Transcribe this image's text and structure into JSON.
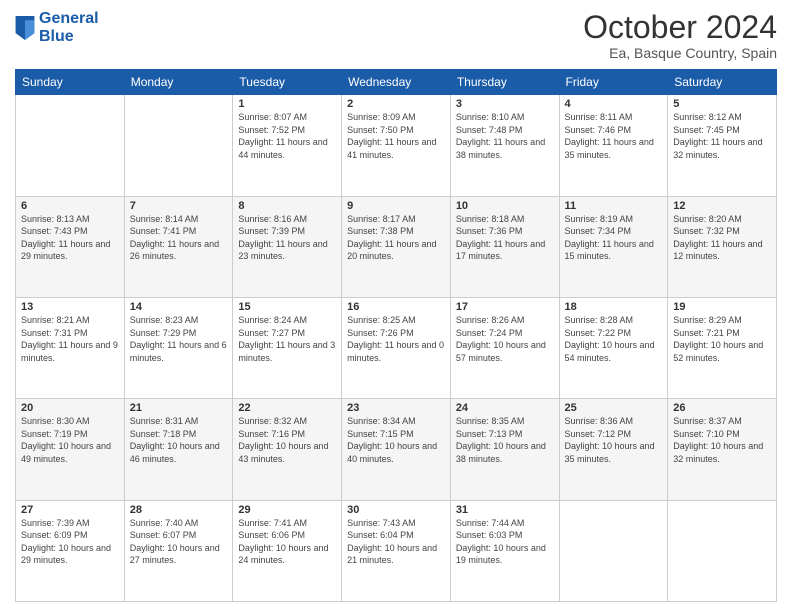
{
  "header": {
    "logo_line1": "General",
    "logo_line2": "Blue",
    "title": "October 2024",
    "subtitle": "Ea, Basque Country, Spain"
  },
  "days_of_week": [
    "Sunday",
    "Monday",
    "Tuesday",
    "Wednesday",
    "Thursday",
    "Friday",
    "Saturday"
  ],
  "weeks": [
    [
      {
        "num": "",
        "info": ""
      },
      {
        "num": "",
        "info": ""
      },
      {
        "num": "1",
        "info": "Sunrise: 8:07 AM\nSunset: 7:52 PM\nDaylight: 11 hours and 44 minutes."
      },
      {
        "num": "2",
        "info": "Sunrise: 8:09 AM\nSunset: 7:50 PM\nDaylight: 11 hours and 41 minutes."
      },
      {
        "num": "3",
        "info": "Sunrise: 8:10 AM\nSunset: 7:48 PM\nDaylight: 11 hours and 38 minutes."
      },
      {
        "num": "4",
        "info": "Sunrise: 8:11 AM\nSunset: 7:46 PM\nDaylight: 11 hours and 35 minutes."
      },
      {
        "num": "5",
        "info": "Sunrise: 8:12 AM\nSunset: 7:45 PM\nDaylight: 11 hours and 32 minutes."
      }
    ],
    [
      {
        "num": "6",
        "info": "Sunrise: 8:13 AM\nSunset: 7:43 PM\nDaylight: 11 hours and 29 minutes."
      },
      {
        "num": "7",
        "info": "Sunrise: 8:14 AM\nSunset: 7:41 PM\nDaylight: 11 hours and 26 minutes."
      },
      {
        "num": "8",
        "info": "Sunrise: 8:16 AM\nSunset: 7:39 PM\nDaylight: 11 hours and 23 minutes."
      },
      {
        "num": "9",
        "info": "Sunrise: 8:17 AM\nSunset: 7:38 PM\nDaylight: 11 hours and 20 minutes."
      },
      {
        "num": "10",
        "info": "Sunrise: 8:18 AM\nSunset: 7:36 PM\nDaylight: 11 hours and 17 minutes."
      },
      {
        "num": "11",
        "info": "Sunrise: 8:19 AM\nSunset: 7:34 PM\nDaylight: 11 hours and 15 minutes."
      },
      {
        "num": "12",
        "info": "Sunrise: 8:20 AM\nSunset: 7:32 PM\nDaylight: 11 hours and 12 minutes."
      }
    ],
    [
      {
        "num": "13",
        "info": "Sunrise: 8:21 AM\nSunset: 7:31 PM\nDaylight: 11 hours and 9 minutes."
      },
      {
        "num": "14",
        "info": "Sunrise: 8:23 AM\nSunset: 7:29 PM\nDaylight: 11 hours and 6 minutes."
      },
      {
        "num": "15",
        "info": "Sunrise: 8:24 AM\nSunset: 7:27 PM\nDaylight: 11 hours and 3 minutes."
      },
      {
        "num": "16",
        "info": "Sunrise: 8:25 AM\nSunset: 7:26 PM\nDaylight: 11 hours and 0 minutes."
      },
      {
        "num": "17",
        "info": "Sunrise: 8:26 AM\nSunset: 7:24 PM\nDaylight: 10 hours and 57 minutes."
      },
      {
        "num": "18",
        "info": "Sunrise: 8:28 AM\nSunset: 7:22 PM\nDaylight: 10 hours and 54 minutes."
      },
      {
        "num": "19",
        "info": "Sunrise: 8:29 AM\nSunset: 7:21 PM\nDaylight: 10 hours and 52 minutes."
      }
    ],
    [
      {
        "num": "20",
        "info": "Sunrise: 8:30 AM\nSunset: 7:19 PM\nDaylight: 10 hours and 49 minutes."
      },
      {
        "num": "21",
        "info": "Sunrise: 8:31 AM\nSunset: 7:18 PM\nDaylight: 10 hours and 46 minutes."
      },
      {
        "num": "22",
        "info": "Sunrise: 8:32 AM\nSunset: 7:16 PM\nDaylight: 10 hours and 43 minutes."
      },
      {
        "num": "23",
        "info": "Sunrise: 8:34 AM\nSunset: 7:15 PM\nDaylight: 10 hours and 40 minutes."
      },
      {
        "num": "24",
        "info": "Sunrise: 8:35 AM\nSunset: 7:13 PM\nDaylight: 10 hours and 38 minutes."
      },
      {
        "num": "25",
        "info": "Sunrise: 8:36 AM\nSunset: 7:12 PM\nDaylight: 10 hours and 35 minutes."
      },
      {
        "num": "26",
        "info": "Sunrise: 8:37 AM\nSunset: 7:10 PM\nDaylight: 10 hours and 32 minutes."
      }
    ],
    [
      {
        "num": "27",
        "info": "Sunrise: 7:39 AM\nSunset: 6:09 PM\nDaylight: 10 hours and 29 minutes."
      },
      {
        "num": "28",
        "info": "Sunrise: 7:40 AM\nSunset: 6:07 PM\nDaylight: 10 hours and 27 minutes."
      },
      {
        "num": "29",
        "info": "Sunrise: 7:41 AM\nSunset: 6:06 PM\nDaylight: 10 hours and 24 minutes."
      },
      {
        "num": "30",
        "info": "Sunrise: 7:43 AM\nSunset: 6:04 PM\nDaylight: 10 hours and 21 minutes."
      },
      {
        "num": "31",
        "info": "Sunrise: 7:44 AM\nSunset: 6:03 PM\nDaylight: 10 hours and 19 minutes."
      },
      {
        "num": "",
        "info": ""
      },
      {
        "num": "",
        "info": ""
      }
    ]
  ]
}
